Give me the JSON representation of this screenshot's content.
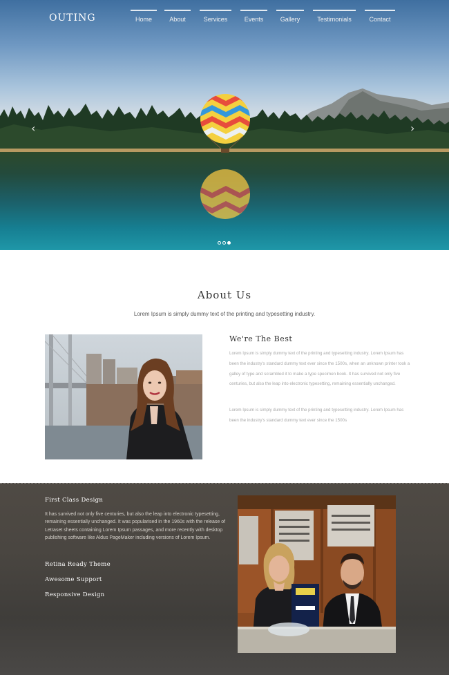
{
  "brand": {
    "logo": "OUTING"
  },
  "nav": {
    "items": [
      {
        "label": "Home"
      },
      {
        "label": "About"
      },
      {
        "label": "Services"
      },
      {
        "label": "Events"
      },
      {
        "label": "Gallery"
      },
      {
        "label": "Testimonials"
      },
      {
        "label": "Contact"
      }
    ]
  },
  "slider": {
    "prev_icon": "chevron-left-icon",
    "next_icon": "chevron-right-icon",
    "prev_glyph": "‹",
    "next_glyph": "›",
    "slide_count": 3,
    "active_slide": 3
  },
  "about": {
    "title": "About Us",
    "subtitle": "Lorem Ipsum is simply dummy text of the printing and typesetting industry.",
    "heading": "We're The Best",
    "paragraph1": "Lorem Ipsum is simply dummy text of the printing and typesetting industry. Lorem Ipsum has been the industry's standard dummy text ever since the 1500s, when an unknown printer took a galley of type and scrambled it to make a type specimen book. It has survived not only five centuries, but also the leap into electronic typesetting, remaining essentially unchanged.",
    "paragraph2": "Lorem Ipsum is simply dummy text of the printing and typesetting industry. Lorem Ipsum has been the industry's standard dummy text ever since the 1500s"
  },
  "features": {
    "title": "First Class Design",
    "paragraph": "It has survived not only five centuries, but also the leap into electronic typesetting, remaining essentially unchanged. It was popularised in the 1960s with the release of Letraset sheets containing Lorem Ipsum passages, and more recently with desktop publishing software like Aldus PageMaker including versions of Lorem Ipsum.",
    "items": [
      {
        "label": "Retina Ready Theme"
      },
      {
        "label": "Awesome Support"
      },
      {
        "label": "Responsive Design"
      }
    ]
  },
  "colors": {
    "nav_text": "#f2f2f2",
    "features_bg": "#4a4641",
    "body_text": "#a8a8a8"
  }
}
